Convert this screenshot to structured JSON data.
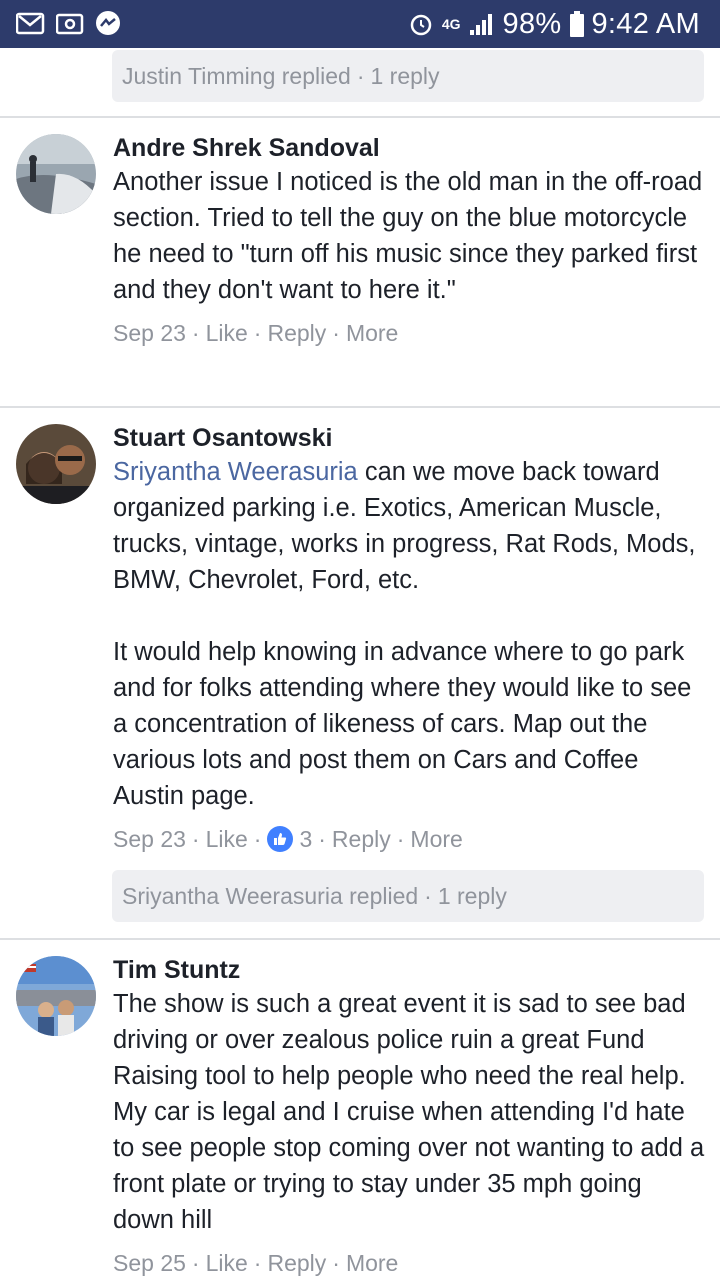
{
  "status_bar": {
    "signal_label": "4G",
    "battery": "98%",
    "time": "9:42 AM",
    "colors": {
      "background": "#2d3b6b"
    },
    "icons": [
      "gmail-icon",
      "outlook-icon",
      "messenger-icon",
      "alarm-icon",
      "signal-icon",
      "battery-icon"
    ]
  },
  "top_reply": {
    "name": "Justin Timming replied",
    "count": "1 reply"
  },
  "comments": [
    {
      "name": "Andre Shrek Sandoval",
      "text": "Another issue I noticed is the old man in the off-road section. Tried to tell the guy on the blue motorcycle he need to \"turn off his music since they parked first and they don't want to here it.\"",
      "date": "Sep 23",
      "like": "Like",
      "reply": "Reply",
      "more": "More"
    },
    {
      "name": "Stuart Osantowski",
      "mention": "Sriyantha Weerasuria",
      "text": " can we move back toward organized parking i.e. Exotics, American Muscle, trucks, vintage, works in progress, Rat Rods, Mods, BMW, Chevrolet, Ford, etc.\n\nIt would help knowing in advance where to go park and for folks attending where they would like to see a concentration of likeness of cars. Map out the various lots and post them on Cars and Coffee Austin page.",
      "date": "Sep 23",
      "like": "Like",
      "reaction_count": "3",
      "reply": "Reply",
      "more": "More",
      "reply_bar": {
        "name": "Sriyantha Weerasuria replied",
        "count": "1 reply"
      }
    },
    {
      "name": "Tim Stuntz",
      "text": "The show is such a great event it is sad to see bad driving or over zealous police ruin a great Fund Raising tool to help people who need the real help. My car is legal and I cruise when attending I'd hate to see people stop coming over not wanting to add a front plate or trying to stay under 35 mph going down hill",
      "date": "Sep 25",
      "like": "Like",
      "reply": "Reply",
      "more": "More"
    }
  ],
  "colors": {
    "link": "#4b67a1",
    "meta": "#90949c",
    "text": "#1d2129",
    "like_badge": "#4080ff"
  }
}
